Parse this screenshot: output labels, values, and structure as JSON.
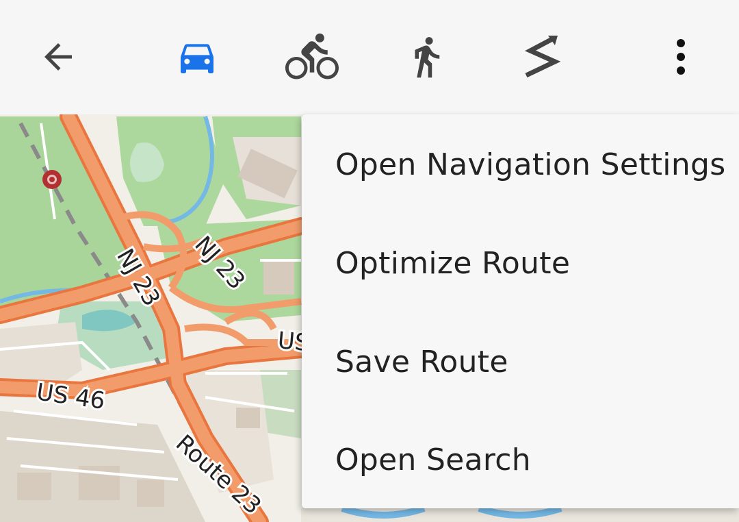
{
  "toolbar": {
    "icons": [
      "back-arrow-icon",
      "car-icon",
      "bicycle-icon",
      "pedestrian-icon",
      "straight-line-icon",
      "more-vert-icon"
    ],
    "active_mode": "car",
    "accent_color": "#1a73e8",
    "icon_color": "#444444"
  },
  "map": {
    "labels": {
      "nj23_a": "NJ 23",
      "nj23_b": "NJ 23",
      "us46": "US 46",
      "us_partial": "US",
      "route23": "Route 23"
    }
  },
  "menu": {
    "items": [
      {
        "label": "Open Navigation Settings"
      },
      {
        "label": "Optimize Route"
      },
      {
        "label": "Save Route"
      },
      {
        "label": "Open Search"
      }
    ]
  }
}
